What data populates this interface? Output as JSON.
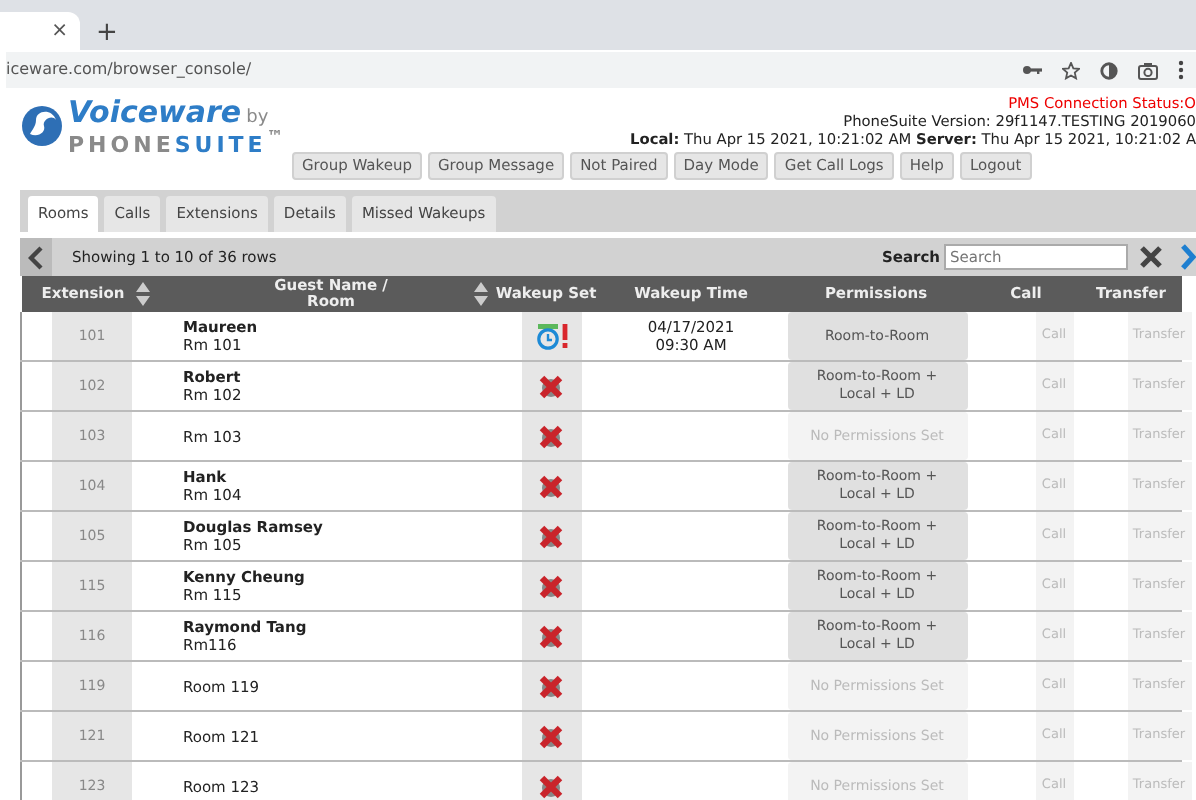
{
  "browser": {
    "tab_close": "×",
    "new_tab": "+",
    "url": "iceware.com/browser_console/"
  },
  "logo": {
    "name": "Voiceware",
    "by": "by",
    "brand_a": "PHONE",
    "brand_b": "SUITE",
    "tm": "™"
  },
  "status": {
    "pms": "PMS Connection Status:O",
    "version": "PhoneSuite Version: 29f1147.TESTING 2019060",
    "clock": "**Local:** Thu Apr 15 2021, 10:21:02 AM **Server:** Thu Apr 15 2021, 10:21:02 A"
  },
  "actions": [
    "Group Wakeup",
    "Group Message",
    "Not Paired",
    "Day Mode",
    "Get Call Logs",
    "Help",
    "Logout"
  ],
  "tabs": [
    {
      "label": "Rooms",
      "selected": true
    },
    {
      "label": "Calls",
      "selected": false
    },
    {
      "label": "Extensions",
      "selected": false
    },
    {
      "label": "Details",
      "selected": false
    },
    {
      "label": "Missed Wakeups",
      "selected": false
    }
  ],
  "toolbar": {
    "showing": "Showing 1 to 10 of 36 rows",
    "search_label": "Search",
    "search_placeholder": "Search"
  },
  "table": {
    "columns": [
      "Extension",
      "Guest Name / Room",
      "Wakeup Set",
      "Wakeup Time",
      "Permissions",
      "Call",
      "Transfer"
    ],
    "rows": [
      {
        "extension": "101",
        "name": "Maureen",
        "room": "Rm 101",
        "wakeup_set": true,
        "wakeup_time": "04/17/2021 09:30 AM",
        "permissions": "Room-to-Room",
        "permission_set": true,
        "call": "Call",
        "transfer": "Transfer"
      },
      {
        "extension": "102",
        "name": "Robert",
        "room": "Rm 102",
        "wakeup_set": false,
        "permissions": "Room-to-Room + Local + LD",
        "permission_set": true,
        "call": "Call",
        "transfer": "Transfer"
      },
      {
        "extension": "103",
        "room": "Rm 103",
        "wakeup_set": false,
        "permissions": "No Permissions Set",
        "permission_set": false,
        "call": "Call",
        "transfer": "Transfer"
      },
      {
        "extension": "104",
        "name": "Hank",
        "room": "Rm 104",
        "wakeup_set": false,
        "permissions": "Room-to-Room + Local + LD",
        "permission_set": true,
        "call": "Call",
        "transfer": "Transfer"
      },
      {
        "extension": "105",
        "name": "Douglas Ramsey",
        "room": "Rm 105",
        "wakeup_set": false,
        "permissions": "Room-to-Room + Local + LD",
        "permission_set": true,
        "call": "Call",
        "transfer": "Transfer"
      },
      {
        "extension": "115",
        "name": "Kenny Cheung",
        "room": "Rm 115",
        "wakeup_set": false,
        "permissions": "Room-to-Room + Local + LD",
        "permission_set": true,
        "call": "Call",
        "transfer": "Transfer"
      },
      {
        "extension": "116",
        "name": "Raymond Tang",
        "room": "Rm116",
        "wakeup_set": false,
        "permissions": "Room-to-Room + Local + LD",
        "permission_set": true,
        "call": "Call",
        "transfer": "Transfer"
      },
      {
        "extension": "119",
        "room": "Room 119",
        "wakeup_set": false,
        "permissions": "No Permissions Set",
        "permission_set": false,
        "call": "Call",
        "transfer": "Transfer"
      },
      {
        "extension": "121",
        "room": "Room 121",
        "wakeup_set": false,
        "permissions": "No Permissions Set",
        "permission_set": false,
        "call": "Call",
        "transfer": "Transfer"
      },
      {
        "extension": "123",
        "room": "Room 123",
        "wakeup_set": false,
        "permissions": "No Permissions Set",
        "permission_set": false,
        "call": "Call",
        "transfer": "Transfer"
      }
    ]
  }
}
